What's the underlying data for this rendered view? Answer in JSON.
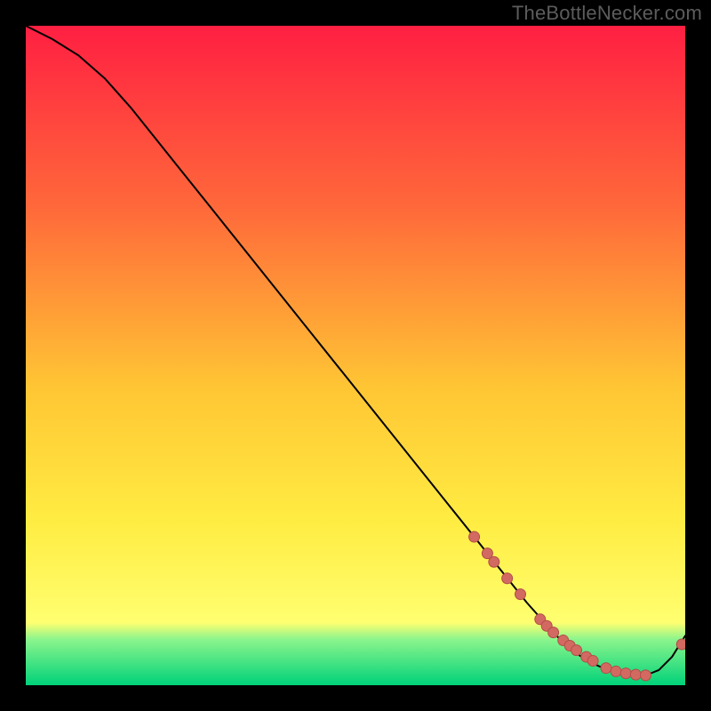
{
  "watermark": "TheBottleNecker.com",
  "colors": {
    "gradient_top": "#ff1f42",
    "gradient_upper_mid": "#ff6a3a",
    "gradient_mid": "#ffc634",
    "gradient_lower_mid": "#ffec42",
    "gradient_yellow_bottom": "#ffff70",
    "gradient_green_start": "#8cf58c",
    "gradient_green_end": "#00d27a",
    "curve": "#000000",
    "marker_fill": "#d26a62",
    "marker_stroke": "#b24d47"
  },
  "chart_data": {
    "type": "line",
    "title": "",
    "xlabel": "",
    "ylabel": "",
    "xlim": [
      0,
      100
    ],
    "ylim": [
      0,
      100
    ],
    "series": [
      {
        "name": "bottleneck-curve",
        "x": [
          0,
          4,
          8,
          12,
          16,
          20,
          24,
          28,
          32,
          36,
          40,
          44,
          48,
          52,
          56,
          60,
          64,
          68,
          72,
          76,
          80,
          82,
          84,
          86,
          88,
          90,
          92,
          94,
          96,
          98,
          100
        ],
        "y": [
          100,
          98,
          95.5,
          92,
          87.5,
          82.5,
          77.5,
          72.5,
          67.5,
          62.5,
          57.5,
          52.5,
          47.5,
          42.5,
          37.5,
          32.5,
          27.5,
          22.5,
          17.5,
          12.5,
          8.0,
          6.0,
          4.5,
          3.3,
          2.4,
          1.8,
          1.5,
          1.5,
          2.3,
          4.3,
          7.5
        ]
      }
    ],
    "markers": {
      "name": "highlight-points",
      "x": [
        68,
        70,
        71,
        73,
        75,
        78,
        79,
        80,
        81.5,
        82.5,
        83.5,
        85,
        86,
        88,
        89.5,
        91,
        92.5,
        94,
        99.5
      ],
      "y": [
        22.5,
        20.0,
        18.7,
        16.2,
        13.8,
        10.0,
        9.0,
        8.0,
        6.8,
        6.0,
        5.3,
        4.3,
        3.7,
        2.6,
        2.1,
        1.8,
        1.6,
        1.5,
        6.2
      ]
    }
  }
}
